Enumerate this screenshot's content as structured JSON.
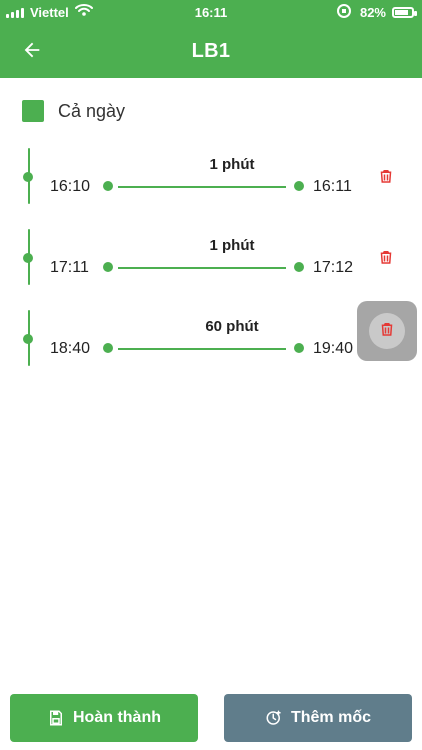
{
  "status": {
    "carrier": "Viettel",
    "time": "16:11",
    "battery": "82%"
  },
  "appbar": {
    "title": "LB1"
  },
  "allDay": {
    "label": "Cả ngày"
  },
  "rows": [
    {
      "duration": "1 phút",
      "start": "16:10",
      "end": "16:11"
    },
    {
      "duration": "1 phút",
      "start": "17:11",
      "end": "17:12"
    },
    {
      "duration": "60 phút",
      "start": "18:40",
      "end": "19:40"
    }
  ],
  "buttons": {
    "save": "Hoàn thành",
    "add": "Thêm mốc"
  },
  "icons": {
    "back": "arrow-left-icon",
    "trash": "trash-icon",
    "save": "floppy-disk-icon",
    "add": "clock-add-icon",
    "wifi": "wifi-icon",
    "battery": "battery-charging-icon",
    "rotation": "rotation-lock-icon"
  },
  "colors": {
    "primary": "#4caf50",
    "danger": "#e53935",
    "secondary": "#607d8b"
  }
}
